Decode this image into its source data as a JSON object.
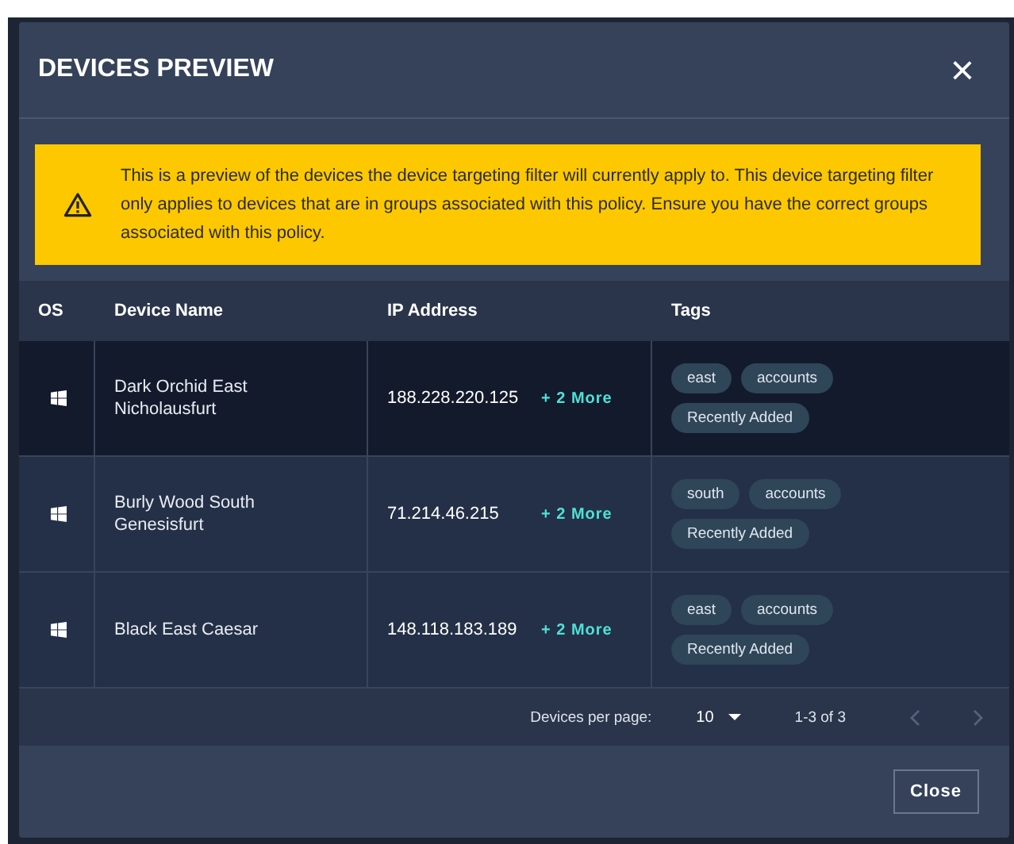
{
  "dialog": {
    "title": "DEVICES PREVIEW",
    "close_icon": "×"
  },
  "banner": {
    "text": "This is a preview of the devices the device targeting filter will currently apply to. This device targeting filter only applies to devices that are in groups associated with this policy. Ensure you have the correct groups associated with this policy."
  },
  "table": {
    "columns": [
      "OS",
      "Device Name",
      "IP Address",
      "Tags"
    ],
    "rows": [
      {
        "kind": "windows",
        "name": "Dark Orchid East Nicholausfurt",
        "ip": "188.228.220.125",
        "more": "+ 2 More",
        "tags": [
          "east",
          "accounts",
          "Recently Added"
        ],
        "highlighted": true
      },
      {
        "kind": "windows",
        "name": "Burly Wood South Genesisfurt",
        "ip": "71.214.46.215",
        "more": "+ 2 More",
        "tags": [
          "south",
          "accounts",
          "Recently Added"
        ],
        "highlighted": false
      },
      {
        "kind": "windows",
        "name": "Black East Caesar",
        "ip": "148.118.183.189",
        "more": "+ 2 More",
        "tags": [
          "east",
          "accounts",
          "Recently Added"
        ],
        "highlighted": false
      }
    ]
  },
  "pagination": {
    "label": "Devices per page:",
    "per_page": "10",
    "range": "1-3 of 3",
    "prev_disabled": true,
    "next_disabled": true
  },
  "buttons": [
    "Close"
  ]
}
